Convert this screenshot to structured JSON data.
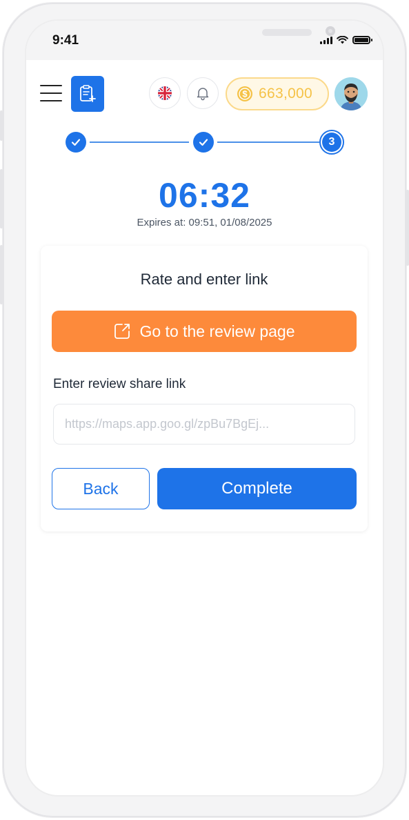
{
  "status_bar": {
    "time": "9:41"
  },
  "header": {
    "menu_icon": "hamburger-menu-icon",
    "task_icon": "clipboard-plus-icon",
    "language_icon": "uk-flag-icon",
    "notification_icon": "bell-icon",
    "coin_icon": "dollar-coin-icon",
    "coins": "663,000"
  },
  "stepper": {
    "steps": [
      {
        "state": "done"
      },
      {
        "state": "done"
      },
      {
        "state": "current",
        "label": "3"
      }
    ]
  },
  "timer": {
    "countdown": "06:32",
    "expires": "Expires at: 09:51, 01/08/2025"
  },
  "card": {
    "title": "Rate and enter link",
    "review_button_label": "Go to the review page",
    "field_label": "Enter review share link",
    "field_placeholder": "https://maps.app.goo.gl/zpBu7BgEj...",
    "field_value": "",
    "back_label": "Back",
    "complete_label": "Complete"
  },
  "colors": {
    "primary": "#1e73e8",
    "accent_orange": "#fd8a3b",
    "coin_gold": "#f5c247"
  }
}
